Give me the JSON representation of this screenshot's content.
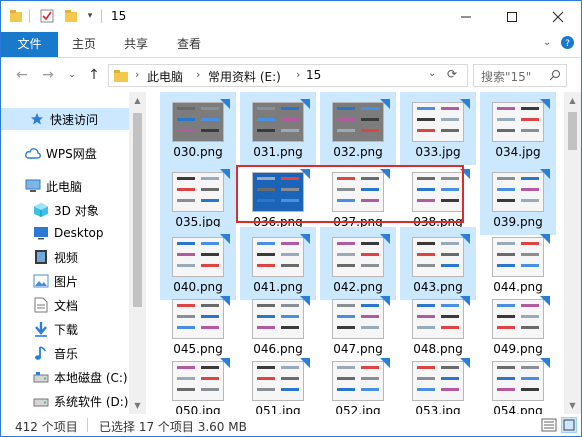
{
  "window": {
    "title": "15"
  },
  "ribbon": {
    "file": "文件",
    "home": "主页",
    "share": "共享",
    "view": "查看"
  },
  "address": {
    "crumbs": [
      "此电脑",
      "常用资料 (E:)",
      "15"
    ],
    "search_placeholder": "搜索\"15\""
  },
  "nav": {
    "items": [
      {
        "label": "快速访问",
        "icon": "star-icon"
      },
      {
        "label": "WPS网盘",
        "icon": "cloud-icon"
      },
      {
        "label": "此电脑",
        "icon": "computer-icon"
      },
      {
        "label": "3D 对象",
        "icon": "cube-icon"
      },
      {
        "label": "Desktop",
        "icon": "desktop-icon"
      },
      {
        "label": "视频",
        "icon": "video-icon"
      },
      {
        "label": "图片",
        "icon": "picture-icon"
      },
      {
        "label": "文档",
        "icon": "document-icon"
      },
      {
        "label": "下载",
        "icon": "download-icon"
      },
      {
        "label": "音乐",
        "icon": "music-icon"
      },
      {
        "label": "本地磁盘 (C:)",
        "icon": "drive-icon"
      },
      {
        "label": "系统软件 (D:)",
        "icon": "drive-icon"
      }
    ]
  },
  "files": [
    {
      "name": "030.png",
      "selected": true
    },
    {
      "name": "031.png",
      "selected": true
    },
    {
      "name": "032.png",
      "selected": true
    },
    {
      "name": "033.jpg",
      "selected": true
    },
    {
      "name": "034.jpg",
      "selected": true
    },
    {
      "name": "035.jpg",
      "selected": true
    },
    {
      "name": "036.png",
      "selected": false
    },
    {
      "name": "037.png",
      "selected": false
    },
    {
      "name": "038.png",
      "selected": false
    },
    {
      "name": "039.png",
      "selected": true
    },
    {
      "name": "040.png",
      "selected": true
    },
    {
      "name": "041.png",
      "selected": true
    },
    {
      "name": "042.png",
      "selected": true
    },
    {
      "name": "043.png",
      "selected": true
    },
    {
      "name": "044.png",
      "selected": false
    },
    {
      "name": "045.png",
      "selected": false
    },
    {
      "name": "046.png",
      "selected": false
    },
    {
      "name": "047.png",
      "selected": false
    },
    {
      "name": "048.png",
      "selected": false
    },
    {
      "name": "049.png",
      "selected": false
    },
    {
      "name": "050.jpg",
      "selected": false
    },
    {
      "name": "051.jpg",
      "selected": false
    },
    {
      "name": "052.jpg",
      "selected": false
    },
    {
      "name": "053.jpg",
      "selected": false
    },
    {
      "name": "054.png",
      "selected": false
    }
  ],
  "status": {
    "count": "412 个项目",
    "selection": "已选择 17 个项目  3.60 MB"
  },
  "colors": {
    "accent": "#1979ca",
    "selection": "#cce8ff",
    "highlight": "#e12a2a"
  }
}
